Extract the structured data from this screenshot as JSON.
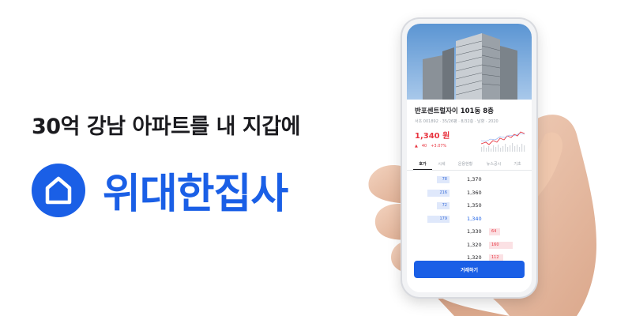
{
  "tagline": "30억 강남 아파트를 내 지갑에",
  "brand": {
    "name": "위대한집사",
    "logo_icon": "house-icon",
    "color": "#1a5fe6"
  },
  "phone": {
    "listing_title": "반포센트럴자이 101동 8층",
    "listing_meta": "서초 001892 · 35/26평 · 8/32층 · 남향 · 2020",
    "price": "1,340 원",
    "change_arrow": "▲",
    "change_abs": "40",
    "change_pct": "+3.07%",
    "tabs": [
      "호가",
      "시세",
      "운용현황",
      "뉴스공시",
      "기초"
    ],
    "active_tab": 0,
    "orderbook": {
      "asks": [
        {
          "price": "1,370",
          "volume": "78"
        },
        {
          "price": "1,360",
          "volume": "216"
        },
        {
          "price": "1,350",
          "volume": "72"
        },
        {
          "price": "1,340",
          "volume": "179"
        }
      ],
      "bids": [
        {
          "price": "1,330",
          "volume": "64"
        },
        {
          "price": "1,320",
          "volume": "160"
        },
        {
          "price": "1,320",
          "volume": "112"
        }
      ]
    },
    "trade_button": "거래하기",
    "colors": {
      "up": "#e8343f",
      "down": "#1a5fe6"
    }
  }
}
